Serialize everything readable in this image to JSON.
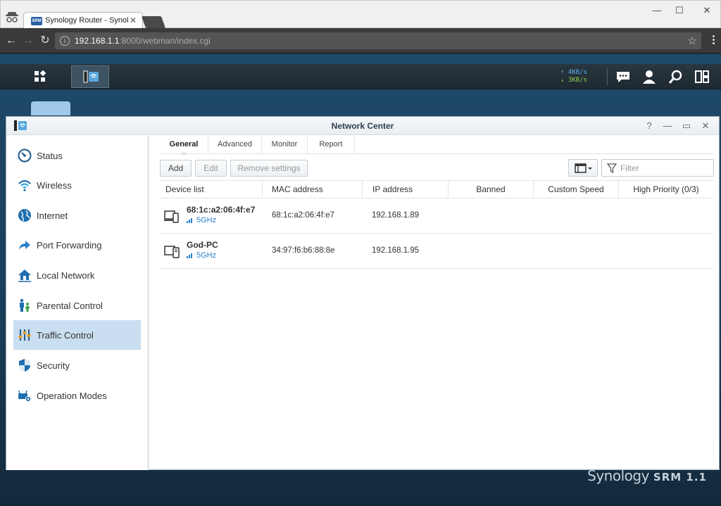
{
  "browser": {
    "tab_title": "Synology Router - Synology",
    "favicon_text": "SRM",
    "url_host": "192.168.1.1",
    "url_path": ":8000/webman/index.cgi"
  },
  "taskbar": {
    "upload_speed": "⇡ 4KB/s",
    "download_speed": "⇣ 3KB/s"
  },
  "window": {
    "title": "Network Center",
    "controls": [
      "?",
      "—",
      "▭",
      "✕"
    ]
  },
  "sidebar": {
    "items": [
      {
        "label": "Status",
        "icon": "gauge-icon"
      },
      {
        "label": "Wireless",
        "icon": "wifi-icon"
      },
      {
        "label": "Internet",
        "icon": "globe-icon"
      },
      {
        "label": "Port Forwarding",
        "icon": "arrow-icon"
      },
      {
        "label": "Local Network",
        "icon": "home-icon"
      },
      {
        "label": "Parental Control",
        "icon": "family-icon"
      },
      {
        "label": "Traffic Control",
        "icon": "sliders-icon"
      },
      {
        "label": "Security",
        "icon": "shield-icon"
      },
      {
        "label": "Operation Modes",
        "icon": "router-gear-icon"
      }
    ],
    "selected_index": 6
  },
  "tabs": [
    "General",
    "Advanced",
    "Monitor",
    "Report"
  ],
  "toolbar": {
    "add_label": "Add",
    "edit_label": "Edit",
    "remove_label": "Remove settings",
    "filter_placeholder": "Filter"
  },
  "grid": {
    "columns": [
      "Device list",
      "MAC address",
      "IP address",
      "Banned",
      "Custom Speed",
      "High Priority (0/3)"
    ],
    "rows": [
      {
        "name": "68:1c:a2:06:4f:e7",
        "band": "5GHz",
        "mac": "68:1c:a2:06:4f:e7",
        "ip": "192.168.1.89",
        "icon": "devices-icon"
      },
      {
        "name": "God-PC",
        "band": "5GHz",
        "mac": "34:97:f6:b6:88:8e",
        "ip": "192.168.1.95",
        "icon": "computer-icon"
      }
    ]
  },
  "branding": {
    "brand": "Synology",
    "product": "SRM 1.1"
  },
  "colors": {
    "accent": "#2d80c8",
    "selected_bg": "#c9def0",
    "desktop_bg": "#1f4a6a"
  }
}
